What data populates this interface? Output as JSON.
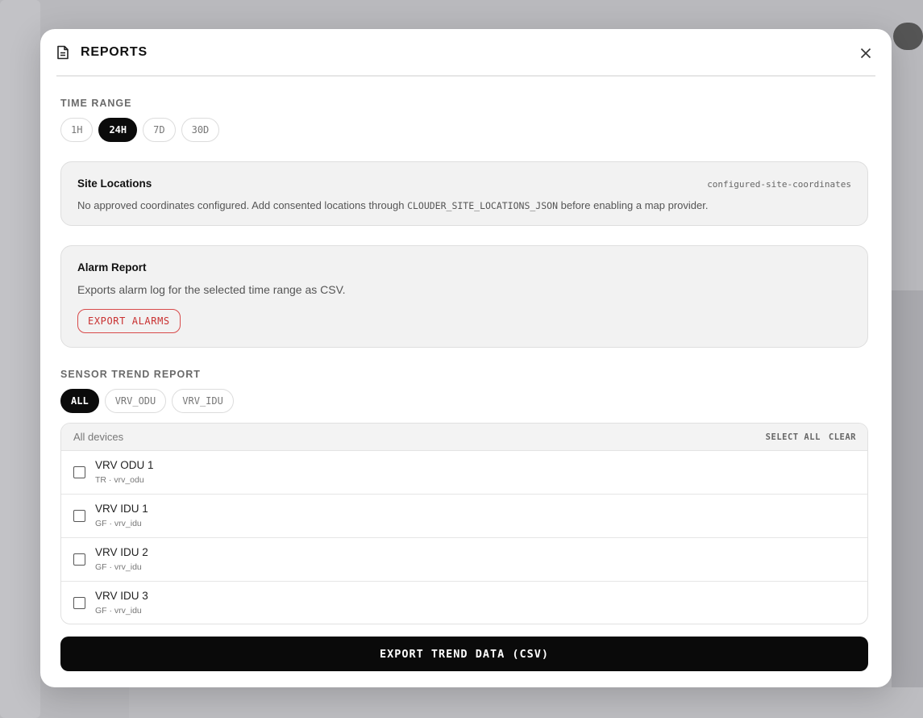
{
  "modal": {
    "title": "REPORTS",
    "icon": "document-icon",
    "close_icon": "close-icon"
  },
  "time_range": {
    "label": "TIME RANGE",
    "options": [
      "1H",
      "24H",
      "7D",
      "30D"
    ],
    "selected": "24H"
  },
  "site_locations": {
    "title": "Site Locations",
    "tag": "configured-site-coordinates",
    "text_before": "No approved coordinates configured. Add consented locations through ",
    "code": "CLOUDER_SITE_LOCATIONS_JSON",
    "text_after": " before enabling a map provider."
  },
  "alarm_report": {
    "title": "Alarm Report",
    "description": "Exports alarm log for the selected time range as CSV.",
    "button_label": "EXPORT ALARMS",
    "button_color": "#c93030"
  },
  "sensor_trend": {
    "label": "SENSOR TREND REPORT",
    "filters": [
      "ALL",
      "VRV_ODU",
      "VRV_IDU"
    ],
    "selected_filter": "ALL",
    "table_header": "All devices",
    "select_all_label": "SELECT ALL",
    "clear_label": "CLEAR",
    "devices": [
      {
        "name": "VRV ODU 1",
        "sub": "TR · vrv_odu",
        "checked": false
      },
      {
        "name": "VRV IDU 1",
        "sub": "GF · vrv_idu",
        "checked": false
      },
      {
        "name": "VRV IDU 2",
        "sub": "GF · vrv_idu",
        "checked": false
      },
      {
        "name": "VRV IDU 3",
        "sub": "GF · vrv_idu",
        "checked": false
      }
    ],
    "export_label": "EXPORT TREND DATA (CSV)"
  }
}
